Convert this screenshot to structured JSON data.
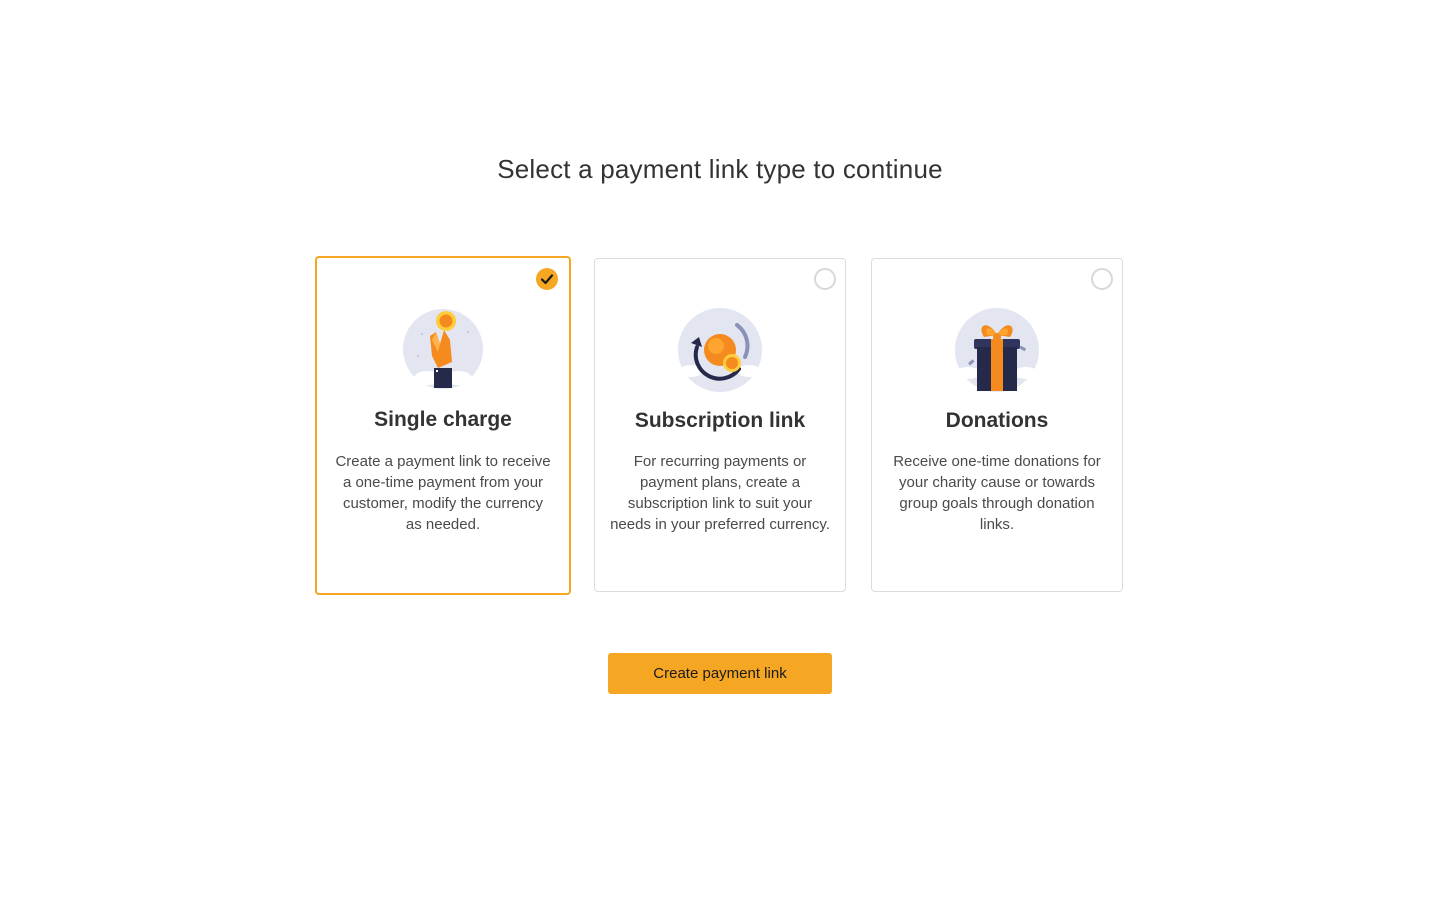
{
  "page": {
    "title": "Select a payment link type to continue"
  },
  "options": [
    {
      "title": "Single charge",
      "description": "Create a payment link to receive a one-time payment from your customer, modify the currency as needed.",
      "selected": true,
      "icon": "hand-holding-coin-icon"
    },
    {
      "title": "Subscription link",
      "description": "For recurring payments or payment plans, create a subscription link to suit your needs in your preferred currency.",
      "selected": false,
      "icon": "recurring-coin-icon"
    },
    {
      "title": "Donations",
      "description": "Receive one-time donations for your charity cause or towards group goals through donation links.",
      "selected": false,
      "icon": "gift-box-icon"
    }
  ],
  "actions": {
    "create_label": "Create payment link"
  },
  "colors": {
    "accent": "#f5a623",
    "text": "#333333",
    "border": "#dcdcdc",
    "illustration_bg": "#e3e5f1",
    "dark_navy": "#252a4a"
  }
}
